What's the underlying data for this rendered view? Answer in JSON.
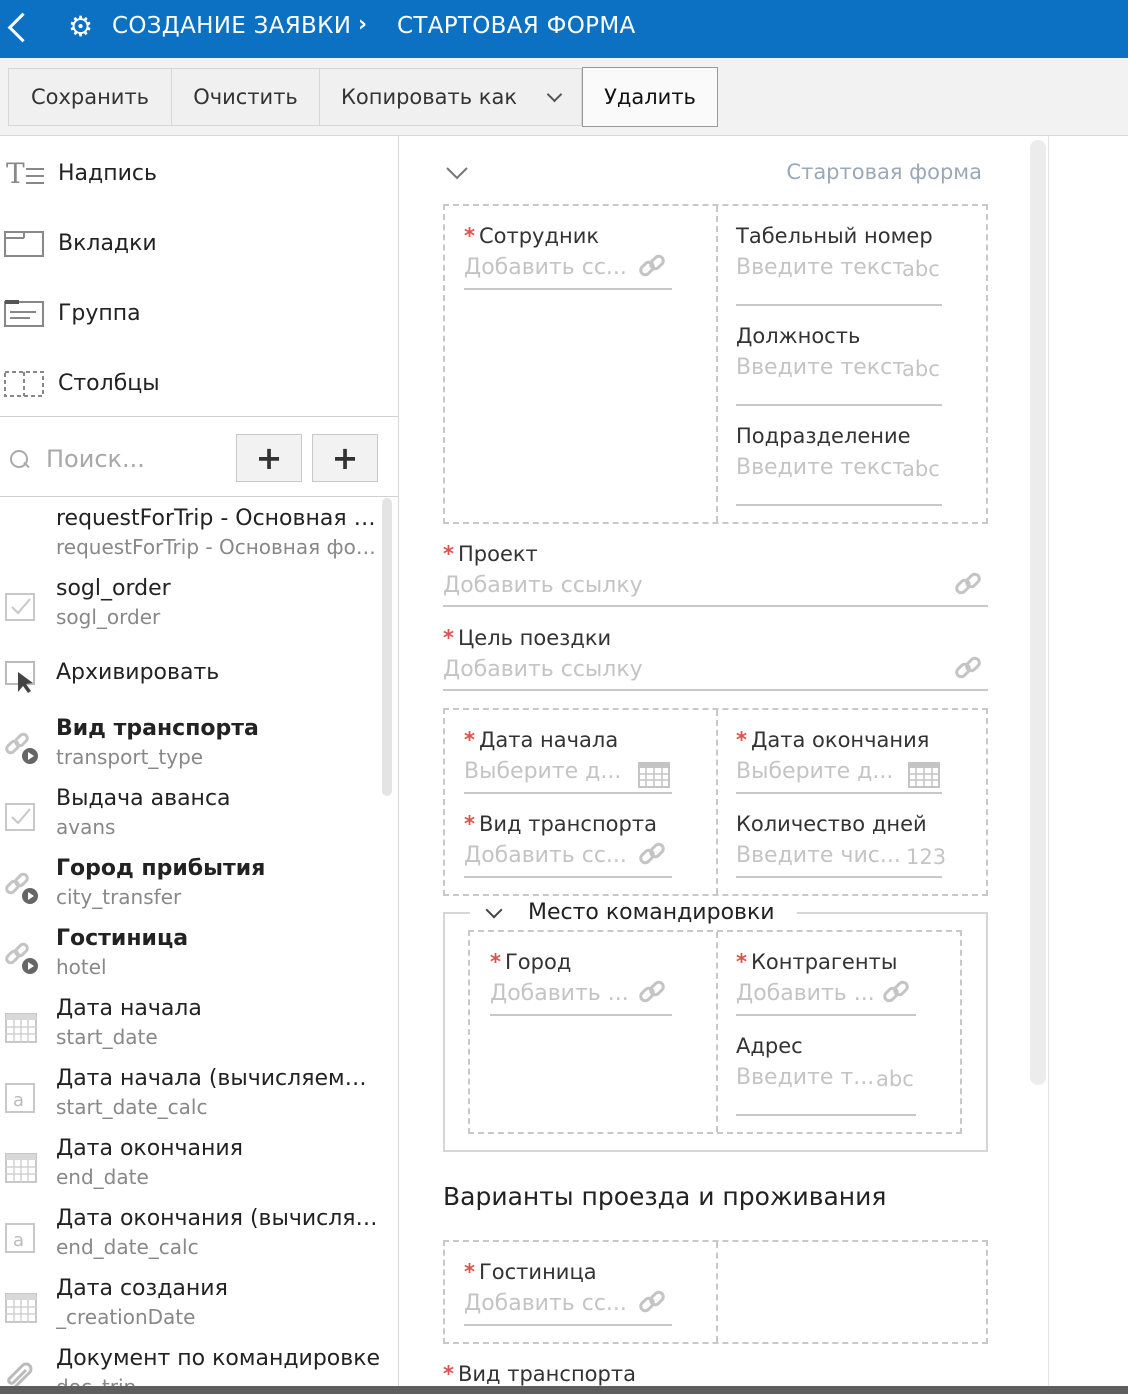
{
  "header": {
    "title": "СОЗДАНИЕ ЗАЯВКИ",
    "separator": "›",
    "subtitle": "СТАРТОВАЯ ФОРМА",
    "back_icon": "chevron-left-icon",
    "settings_icon": "gear-icon"
  },
  "toolbar": {
    "save": "Сохранить",
    "clear": "Очистить",
    "copy_as": "Копировать как",
    "delete": "Удалить"
  },
  "tools": [
    {
      "label": "Надпись",
      "icon": "text-label-icon"
    },
    {
      "label": "Вкладки",
      "icon": "tabs-icon"
    },
    {
      "label": "Группа",
      "icon": "group-icon"
    },
    {
      "label": "Столбцы",
      "icon": "columns-icon"
    }
  ],
  "search": {
    "placeholder": "Поиск...",
    "add1": "+",
    "add2": "+"
  },
  "fields": [
    {
      "title": "requestForTrip - Основная форма",
      "sub": "requestForTrip - Основная форма",
      "bold": false,
      "icon": "none"
    },
    {
      "title": "sogl_order",
      "sub": "sogl_order",
      "bold": false,
      "icon": "checkbox-icon"
    },
    {
      "title": "Архивировать",
      "sub": "",
      "bold": false,
      "icon": "cursor-icon"
    },
    {
      "title": "Вид транспорта",
      "sub": "transport_type",
      "bold": true,
      "icon": "link-play-icon"
    },
    {
      "title": "Выдача аванса",
      "sub": "avans",
      "bold": false,
      "icon": "checkbox-icon"
    },
    {
      "title": "Город прибытия",
      "sub": "city_transfer",
      "bold": true,
      "icon": "link-play-icon"
    },
    {
      "title": "Гостиница",
      "sub": "hotel",
      "bold": true,
      "icon": "link-play-icon"
    },
    {
      "title": "Дата начала",
      "sub": "start_date",
      "bold": false,
      "icon": "calendar-icon"
    },
    {
      "title": "Дата начала (вычисляемый)",
      "sub": "start_date_calc",
      "bold": false,
      "icon": "text-a-icon"
    },
    {
      "title": "Дата окончания",
      "sub": "end_date",
      "bold": false,
      "icon": "calendar-icon"
    },
    {
      "title": "Дата окончания (вычисляемый)",
      "sub": "end_date_calc",
      "bold": false,
      "icon": "text-a-icon"
    },
    {
      "title": "Дата создания",
      "sub": "_creationDate",
      "bold": false,
      "icon": "calendar-icon"
    },
    {
      "title": "Документ по командировке",
      "sub": "doc_trip",
      "bold": false,
      "icon": "paperclip-icon"
    }
  ],
  "form": {
    "title": "Стартовая форма",
    "employee": {
      "label": "Сотрудник",
      "placeholder": "Добавить сс..."
    },
    "tab_number": {
      "label": "Табельный номер",
      "placeholder": "Введите текст",
      "suffix": "abc"
    },
    "position": {
      "label": "Должность",
      "placeholder": "Введите текст",
      "suffix": "abc"
    },
    "department": {
      "label": "Подразделение",
      "placeholder": "Введите текст",
      "suffix": "abc"
    },
    "project": {
      "label": "Проект",
      "placeholder": "Добавить ссылку"
    },
    "trip_goal": {
      "label": "Цель поездки",
      "placeholder": "Добавить ссылку"
    },
    "start_date": {
      "label": "Дата начала",
      "placeholder": "Выберите д..."
    },
    "end_date": {
      "label": "Дата окончания",
      "placeholder": "Выберите д..."
    },
    "transport": {
      "label": "Вид транспорта",
      "placeholder": "Добавить сс..."
    },
    "days": {
      "label": "Количество дней",
      "placeholder": "Введите чис...",
      "suffix": "123"
    },
    "group_title": "Место командировки",
    "city": {
      "label": "Город",
      "placeholder": "Добавить ..."
    },
    "contractors": {
      "label": "Контрагенты",
      "placeholder": "Добавить ..."
    },
    "address": {
      "label": "Адрес",
      "placeholder": "Введите т...",
      "suffix": "abc"
    },
    "section_title": "Варианты проезда и проживания",
    "hotel": {
      "label": "Гостиница",
      "placeholder": "Добавить сс..."
    },
    "transport2": {
      "label": "Вид транспорта"
    },
    "required_mark": "*"
  }
}
